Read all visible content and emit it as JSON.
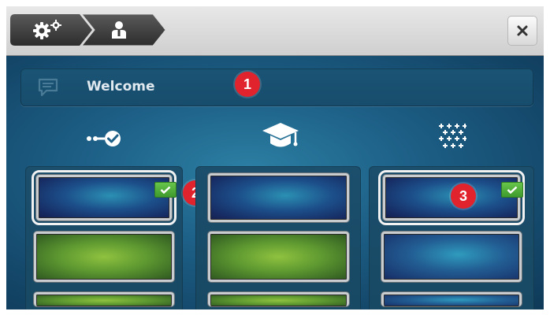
{
  "header": {
    "breadcrumbs": [
      {
        "icon": "gears-icon"
      },
      {
        "icon": "person-icon"
      }
    ],
    "close_label": "×"
  },
  "welcome": {
    "title": "Welcome",
    "icon": "speech-bubble-icon"
  },
  "callouts": [
    "1",
    "2",
    "3"
  ],
  "categories": [
    {
      "icon": "dots-check-icon"
    },
    {
      "icon": "graduation-cap-icon"
    },
    {
      "icon": "crosses-pattern-icon"
    }
  ],
  "columns": [
    {
      "tiles": [
        "blue",
        "green",
        "partial"
      ],
      "selected_tile": 0
    },
    {
      "tiles": [
        "blue",
        "green",
        "partial"
      ],
      "selected_tile": null
    },
    {
      "tiles": [
        "blue",
        "blue",
        "partial"
      ],
      "selected_tile": 0
    }
  ],
  "colors": {
    "accent_red": "#e0232d",
    "check_green": "#4caf36",
    "panel_blue": "#1d5f86"
  }
}
